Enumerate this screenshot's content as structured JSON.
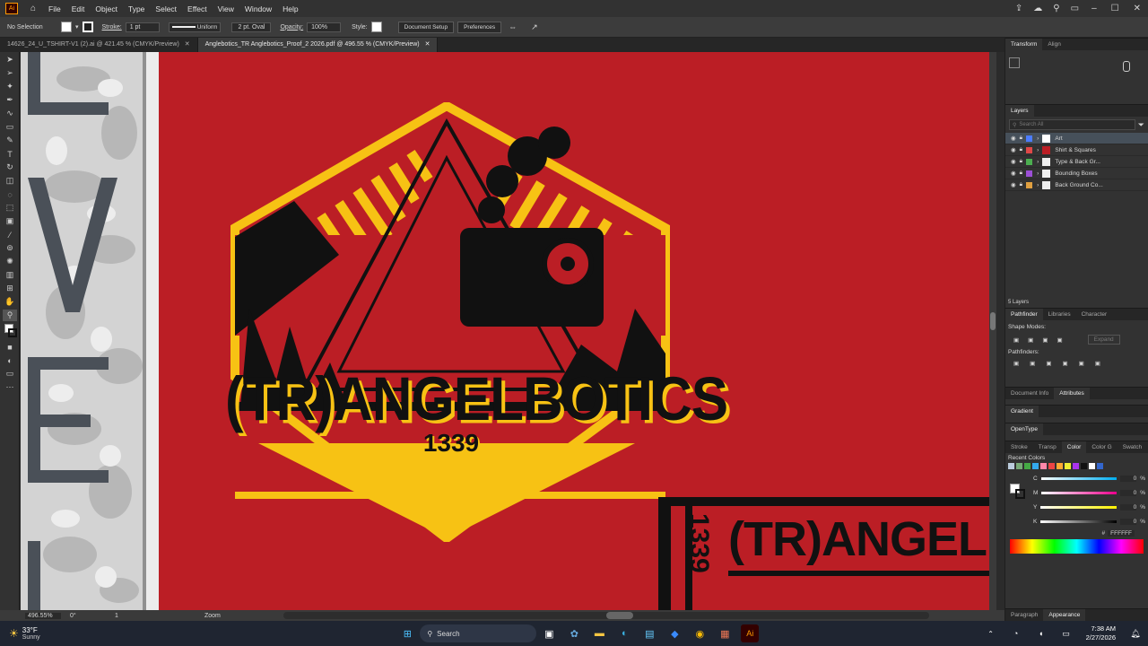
{
  "menu": {
    "items": [
      "File",
      "Edit",
      "Object",
      "Type",
      "Select",
      "Effect",
      "View",
      "Window",
      "Help"
    ]
  },
  "control": {
    "selection": "No Selection",
    "stroke_label": "Stroke:",
    "stroke_value": "1 pt",
    "stroke_profile": "Uniform",
    "brush": "2 pt. Oval",
    "opacity_label": "Opacity:",
    "opacity_value": "100%",
    "style_label": "Style:",
    "document_setup": "Document Setup",
    "preferences": "Preferences"
  },
  "tabs": [
    {
      "label": "14626_24_U_TSHIRT-V1 (2).ai @ 421.45 % (CMYK/Preview)"
    },
    {
      "label": "Anglebotics_TR Anglebotics_Proof_2 2026.pdf @ 496.55 % (CMYK/Preview)"
    }
  ],
  "artwork": {
    "title": "(TR)ANGELBOTICS",
    "number": "1339",
    "partial_title": "(TR)ANGELBOT",
    "partial_number": "1339"
  },
  "status": {
    "zoom": "496.55%",
    "rotation": "0°",
    "artboard": "1",
    "tool": "Zoom"
  },
  "panel": {
    "top_tabs": [
      "Transform",
      "Align"
    ],
    "layers_tab": "Layers",
    "layers_search": "Search All",
    "layers": [
      "Art",
      "Shirt & Squares",
      "Type & Back Gr...",
      "Bounding Boxes",
      "Back Ground Co..."
    ],
    "layers_count": "5 Layers",
    "mid_tabs": [
      "Pathfinder",
      "Libraries",
      "Character"
    ],
    "shape_modes": "Shape Modes:",
    "expand": "Expand",
    "pathfinders": "Pathfinders:",
    "info_tabs": [
      "Document Info",
      "Attributes"
    ],
    "gradient": "Gradient",
    "opentype": "OpenType",
    "color_tabs": [
      "Stroke",
      "Transp",
      "Color",
      "Color G",
      "Swatch"
    ],
    "recent_colors": "Recent Colors",
    "cmyk": [
      {
        "label": "C",
        "value": "0"
      },
      {
        "label": "M",
        "value": "0"
      },
      {
        "label": "Y",
        "value": "0"
      },
      {
        "label": "K",
        "value": "0"
      }
    ],
    "hex": "FFFFFF",
    "bottom_tabs": [
      "Paragraph",
      "Appearance"
    ]
  },
  "colors": {
    "bg_red": "#bb1e25",
    "yellow": "#f7c214",
    "black": "#111111"
  },
  "taskbar": {
    "temp": "33°F",
    "weather": "Sunny",
    "search": "Search",
    "time": "7:38 AM",
    "date": "2/27/2026"
  }
}
